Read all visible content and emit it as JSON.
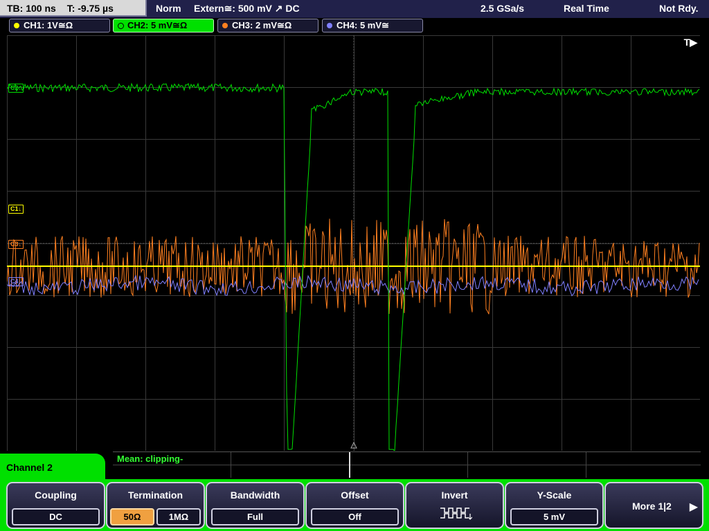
{
  "status": {
    "timebase": "TB: 100 ns",
    "trigger_time": "T: -9.75 µs",
    "mode": "Norm",
    "trigger": "Extern≅: 500 mV ↗ DC",
    "sample_rate": "2.5 GSa/s",
    "acquisition": "Real Time",
    "state": "Not Rdy."
  },
  "channels": [
    {
      "label": "CH1: 1V≅Ω",
      "color": "#ffff00"
    },
    {
      "label": "CH2: 5 mV≅Ω",
      "color": "#00e000"
    },
    {
      "label": "CH3: 2 mV≅Ω",
      "color": "#ff8020"
    },
    {
      "label": "CH4: 5 mV≅",
      "color": "#8080ff"
    }
  ],
  "display": {
    "trigger_marker": "T▶",
    "markers": {
      "c1": "C1↓",
      "c2": "C2↓",
      "c3": "C3↓",
      "c4": "C4↓"
    }
  },
  "measurement": {
    "text": "Mean: clipping-"
  },
  "menu": {
    "title": "Channel 2",
    "coupling": {
      "title": "Coupling",
      "value": "DC"
    },
    "termination": {
      "title": "Termination",
      "opt1": "50Ω",
      "opt2": "1MΩ",
      "selected": "50Ω"
    },
    "bandwidth": {
      "title": "Bandwidth",
      "value": "Full"
    },
    "offset": {
      "title": "Offset",
      "value": "Off"
    },
    "invert": {
      "title": "Invert",
      "icon": "invert-waveform-icon"
    },
    "yscale": {
      "title": "Y-Scale",
      "value": "5 mV"
    },
    "more": {
      "label": "More 1|2",
      "icon": "right-arrow-icon"
    }
  }
}
